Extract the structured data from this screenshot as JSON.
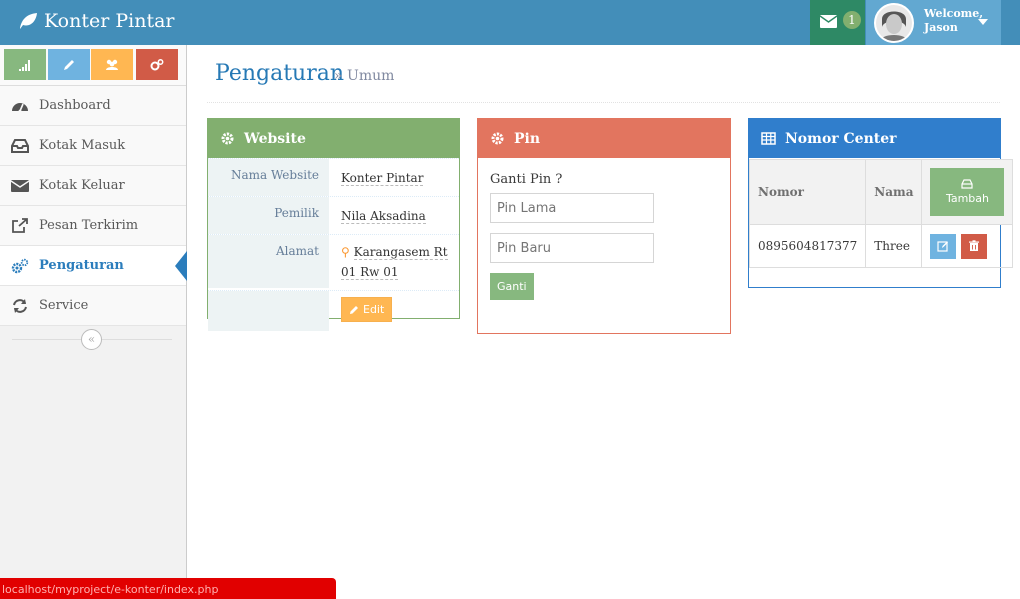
{
  "navbar": {
    "brand": "Konter Pintar",
    "messages_count": "1",
    "welcome": "Welcome,",
    "user_name": "Jason"
  },
  "sidebar": {
    "shortcut_colors": [
      "#87b87f",
      "#6fb3e0",
      "#ffb752",
      "#d15b47"
    ],
    "shortcut_icons": [
      "signal-icon",
      "pencil-icon",
      "users-icon",
      "cogs-icon"
    ],
    "items": [
      {
        "label": "Dashboard",
        "icon": "dashboard-icon",
        "active": false
      },
      {
        "label": "Kotak Masuk",
        "icon": "inbox-icon",
        "active": false
      },
      {
        "label": "Kotak Keluar",
        "icon": "envelope-icon",
        "active": false
      },
      {
        "label": "Pesan Terkirim",
        "icon": "external-link-icon",
        "active": false
      },
      {
        "label": "Pengaturan",
        "icon": "cogs-icon",
        "active": true
      },
      {
        "label": "Service",
        "icon": "refresh-icon",
        "active": false
      }
    ]
  },
  "page": {
    "title": "Pengaturan",
    "subtitle": "Umum"
  },
  "website": {
    "title": "Website",
    "rows": [
      {
        "label": "Nama Website",
        "value": "Konter Pintar"
      },
      {
        "label": "Pemilik",
        "value": "Nila Aksadina"
      },
      {
        "label": "Alamat",
        "value": "Karangasem Rt 01 Rw 01"
      }
    ],
    "edit_label": "Edit"
  },
  "pin": {
    "title": "Pin",
    "question": "Ganti Pin ?",
    "old_placeholder": "Pin Lama",
    "new_placeholder": "Pin Baru",
    "submit_label": "Ganti"
  },
  "nomor_center": {
    "title": "Nomor Center",
    "columns": [
      "Nomor",
      "Nama"
    ],
    "add_label": "Tambah",
    "rows": [
      {
        "nomor": "0895604817377",
        "nama": "Three"
      }
    ]
  },
  "status_url": "localhost/myproject/e-konter/index.php",
  "colors": {
    "navbar": "#438eb9",
    "success": "#82af6f",
    "danger": "#e2755f",
    "primary": "#307ecc",
    "warning": "#ffb752"
  }
}
